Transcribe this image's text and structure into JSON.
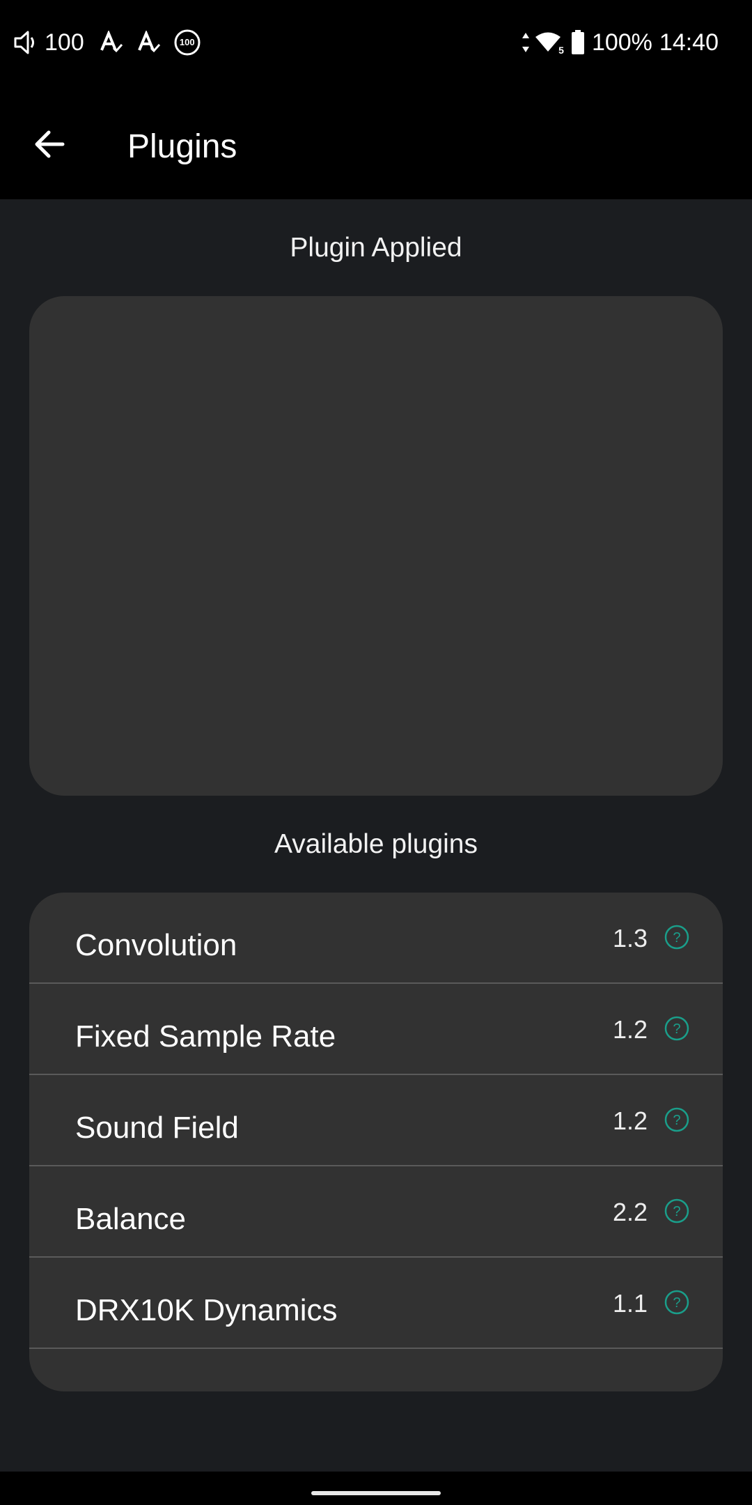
{
  "status_bar": {
    "volume_level": "100",
    "badge_value": "100",
    "battery_percent": "100%",
    "time": "14:40",
    "network_label": "5"
  },
  "header": {
    "title": "Plugins"
  },
  "applied": {
    "heading": "Plugin Applied"
  },
  "available": {
    "heading": "Available plugins",
    "items": [
      {
        "name": "Convolution",
        "version": "1.3"
      },
      {
        "name": "Fixed Sample Rate",
        "version": "1.2"
      },
      {
        "name": "Sound Field",
        "version": "1.2"
      },
      {
        "name": "Balance",
        "version": "2.2"
      },
      {
        "name": "DRX10K Dynamics",
        "version": "1.1"
      }
    ]
  },
  "colors": {
    "accent": "#1a9e8a",
    "background": "#1b1d20",
    "panel": "#323232"
  }
}
